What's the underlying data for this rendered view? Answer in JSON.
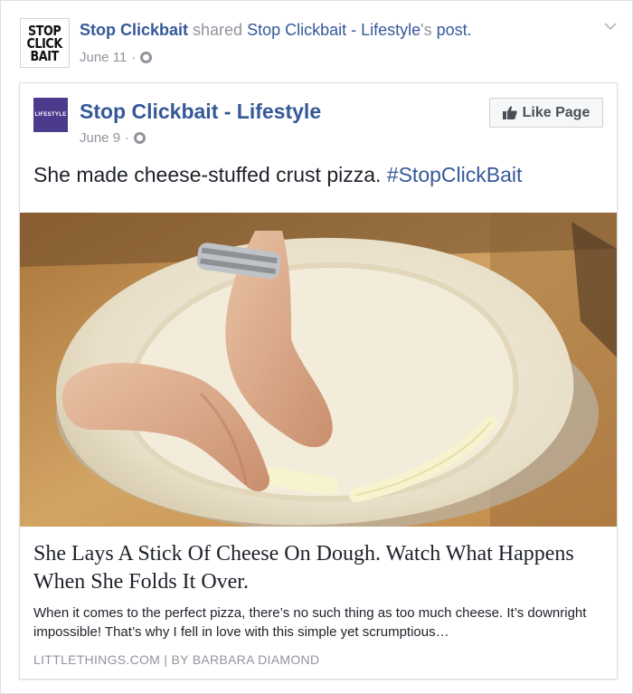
{
  "outer": {
    "avatar_logo": [
      "STOP",
      "CLICK",
      "BAIT"
    ],
    "author": "Stop Clickbait",
    "shared_word": " shared ",
    "shared_page": "Stop Clickbait - Lifestyle",
    "possessive": "'s ",
    "post_word": "post.",
    "date": "June 11",
    "separator": "·",
    "privacy_icon": "globe-icon",
    "menu_icon": "chevron-down-icon"
  },
  "shared_post": {
    "avatar_text": "LIFESTYLE",
    "page_name": "Stop Clickbait - Lifestyle",
    "date": "June 9",
    "separator": "·",
    "like_button": "Like Page",
    "status_text": "She made cheese-stuffed crust pizza. ",
    "hashtag": "#StopClickBait",
    "link": {
      "title": "She Lays A Stick Of Cheese On Dough. Watch What Happens When She Folds It Over.",
      "description": "When it comes to the perfect pizza, there’s no such thing as too much cheese. It’s downright impossible! That’s why I fell in love with this simple yet scrumptious…",
      "source": "LITTLETHINGS.COM",
      "divider": "|",
      "byline": "BY BARBARA DIAMOND"
    }
  },
  "colors": {
    "link_blue": "#365899",
    "meta_gray": "#90949c",
    "text": "#1d2129",
    "border": "#dddfe2",
    "avatar_purple": "#4c3a8c"
  }
}
